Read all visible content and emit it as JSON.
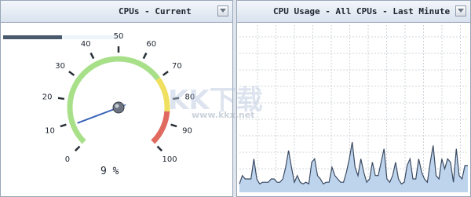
{
  "left_panel": {
    "title": "CPUs - Current",
    "gauge": {
      "min": 0,
      "max": 100,
      "value": 9,
      "tick_labels": [
        "0",
        "10",
        "20",
        "30",
        "40",
        "50",
        "60",
        "70",
        "80",
        "90",
        "100"
      ],
      "readout": "9 %",
      "bands": [
        {
          "from": 0,
          "to": 70,
          "color": "#a8e08a"
        },
        {
          "from": 70,
          "to": 85,
          "color": "#f0e060"
        },
        {
          "from": 85,
          "to": 100,
          "color": "#e06a60"
        }
      ],
      "needle_color": "#3a64b8"
    },
    "top_bar_fill": 0.5
  },
  "right_panel": {
    "title": "CPU Usage - All CPUs - Last Minute",
    "graph": {
      "type": "area",
      "ylim": [
        0,
        100
      ],
      "grid": true,
      "values": [
        5,
        10,
        8,
        8,
        8,
        20,
        8,
        5,
        6,
        6,
        6,
        8,
        8,
        6,
        6,
        8,
        15,
        25,
        15,
        6,
        10,
        6,
        5,
        6,
        5,
        18,
        20,
        10,
        8,
        5,
        6,
        6,
        15,
        10,
        8,
        6,
        6,
        12,
        20,
        30,
        15,
        10,
        20,
        12,
        6,
        8,
        18,
        10,
        10,
        18,
        26,
        8,
        6,
        10,
        18,
        8,
        5,
        6,
        16,
        20,
        8,
        8,
        20,
        12,
        8,
        6,
        18,
        28,
        10,
        8,
        20,
        14,
        20,
        18,
        6,
        26,
        10,
        8,
        16,
        16
      ],
      "line_color": "#3a4a62",
      "fill_color": "#bdd4ec"
    }
  },
  "watermark": {
    "text": "KK下载",
    "url": "www.kkx.net"
  }
}
